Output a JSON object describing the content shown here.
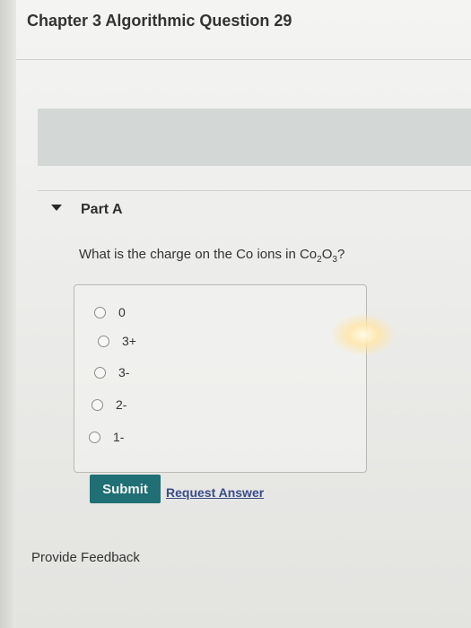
{
  "header": {
    "title": "Chapter 3 Algorithmic Question 29"
  },
  "part": {
    "title": "Part A"
  },
  "question": {
    "text_before": "What is the charge on the Co ions in Co",
    "sub1": "2",
    "mid": "O",
    "sub2": "3",
    "text_after": "?"
  },
  "options": [
    {
      "label": "0",
      "selected": false
    },
    {
      "label": "3+",
      "selected": false
    },
    {
      "label": "3-",
      "selected": false
    },
    {
      "label": "2-",
      "selected": false
    },
    {
      "label": "1-",
      "selected": false
    }
  ],
  "actions": {
    "submit_label": "Submit",
    "request_label": "Request Answer"
  },
  "footer": {
    "feedback_label": "Provide Feedback"
  },
  "colors": {
    "submit_bg": "#1f6f74",
    "link": "#3a4c8a",
    "banner": "#d3d8d6"
  }
}
